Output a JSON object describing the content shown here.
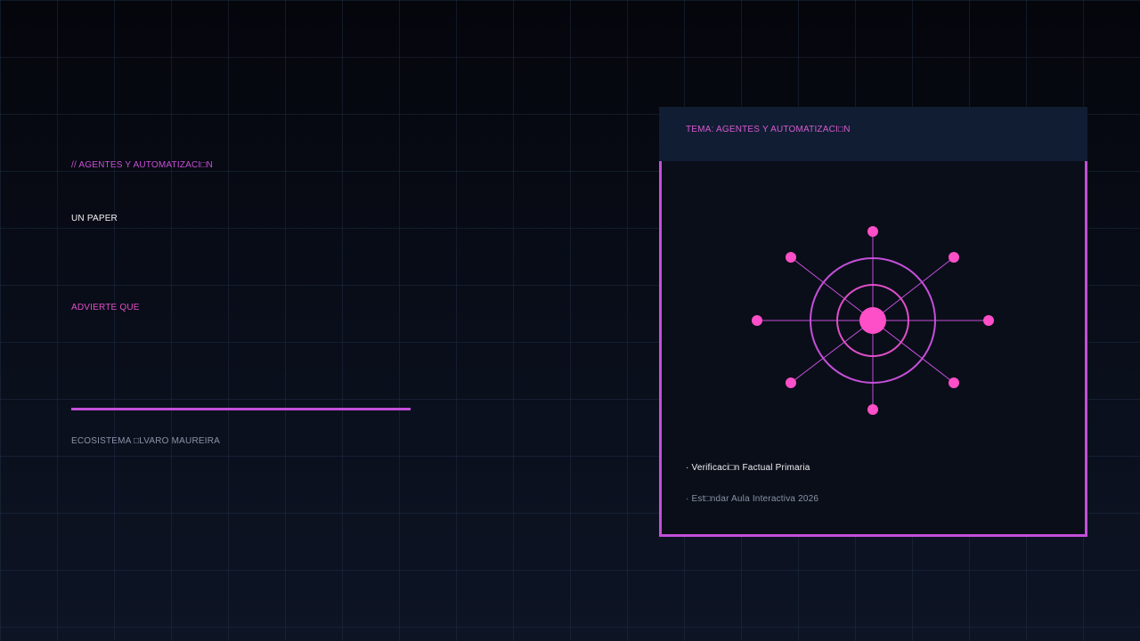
{
  "left": {
    "kicker": "// AGENTES Y AUTOMATIZACI□N",
    "headline": "UN PAPER",
    "subhead": "ADVIERTE QUE",
    "footer": "ECOSISTEMA □LVARO MAUREIRA"
  },
  "card": {
    "tag": "TEMA: AGENTES Y AUTOMATIZACI□N",
    "items": [
      "· Verificaci□n Factual Primaria",
      "· Est□ndar Aula Interactiva 2026"
    ]
  },
  "diagram": {
    "icon": "network-hub-icon"
  },
  "colors": {
    "accent_purple": "#c44fd9",
    "accent_pink": "#ff4fc8",
    "card_header_bg": "#111d33",
    "text_muted": "#8a93a6"
  }
}
